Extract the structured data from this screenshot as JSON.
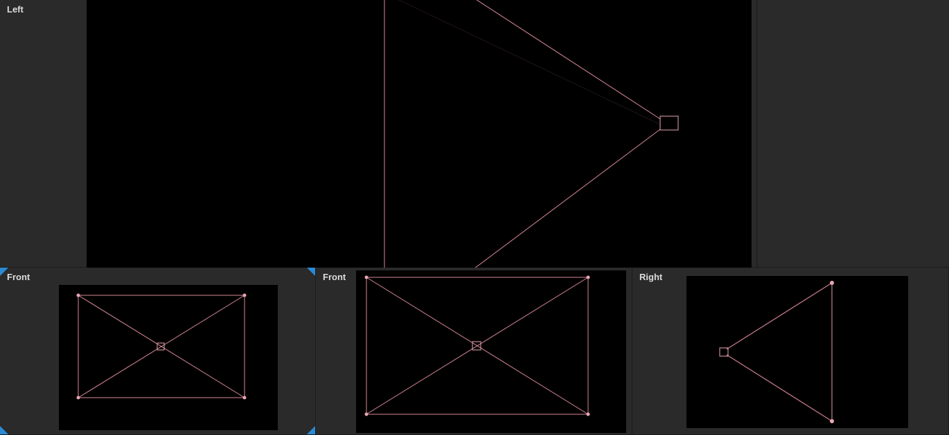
{
  "viewports": {
    "left": {
      "label": "Left"
    },
    "front1": {
      "label": "Front",
      "selected": true
    },
    "front2": {
      "label": "Front"
    },
    "right": {
      "label": "Right"
    }
  },
  "gizmo": {
    "color": "#d98a99",
    "vertex_color": "#e8a8b4",
    "type": "camera-frustum"
  }
}
